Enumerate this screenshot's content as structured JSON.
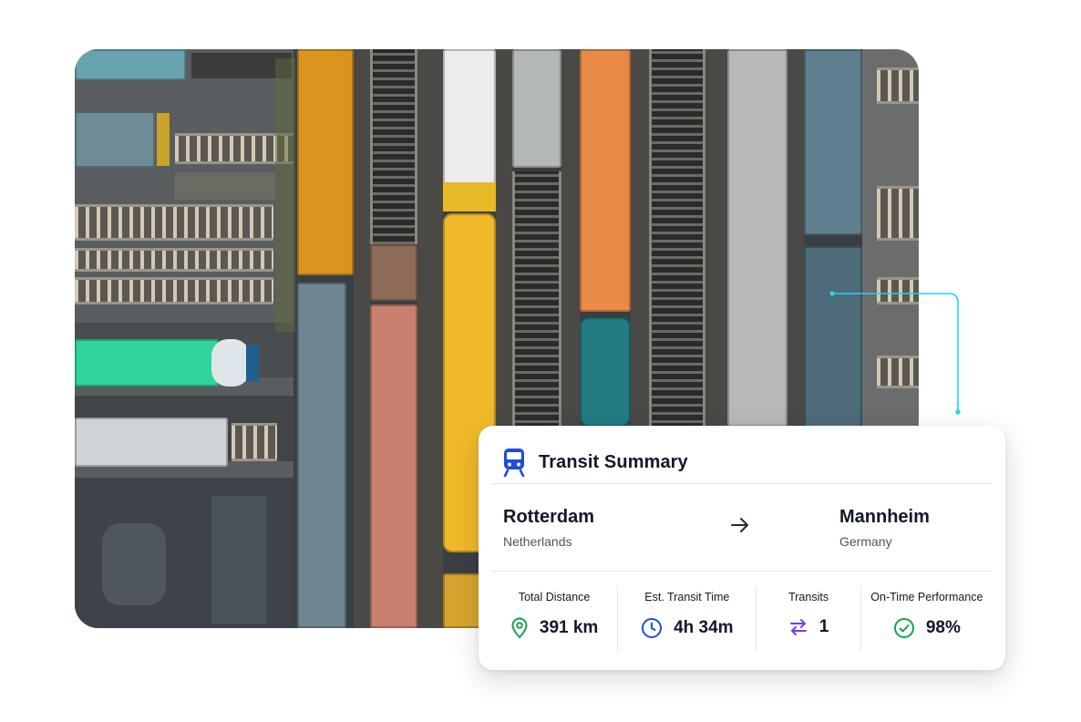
{
  "card": {
    "title": "Transit Summary",
    "icon": "train-icon",
    "origin": {
      "city": "Rotterdam",
      "country": "Netherlands"
    },
    "destination": {
      "city": "Mannheim",
      "country": "Germany"
    },
    "stats": [
      {
        "label": "Total Distance",
        "value": "391 km",
        "icon": "location-pin-icon",
        "color": "#16a34a"
      },
      {
        "label": "Est. Transit Time",
        "value": "4h 34m",
        "icon": "clock-icon",
        "color": "#1d4ed8"
      },
      {
        "label": "Transits",
        "value": "1",
        "icon": "swap-arrows-icon",
        "color": "#7c3aed"
      },
      {
        "label": "On-Time Performance",
        "value": "98%",
        "icon": "check-circle-icon",
        "color": "#16a34a"
      }
    ]
  },
  "colors": {
    "accent": "#2563eb",
    "connector": "#22d3ee"
  }
}
